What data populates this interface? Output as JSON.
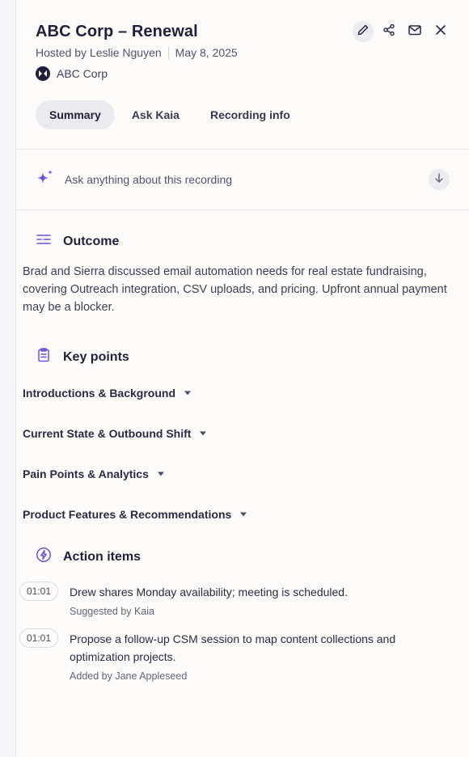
{
  "header": {
    "title": "ABC Corp – Renewal",
    "host": "Hosted by Leslie Nguyen",
    "date": "May 8, 2025",
    "org_name": "ABC Corp"
  },
  "tabs": [
    {
      "label": "Summary",
      "active": true
    },
    {
      "label": "Ask Kaia",
      "active": false
    },
    {
      "label": "Recording info",
      "active": false
    }
  ],
  "ask": {
    "placeholder": "Ask anything about this recording"
  },
  "outcome": {
    "heading": "Outcome",
    "text": "Brad and Sierra discussed email automation needs for real estate fundraising, covering Outreach integration, CSV uploads, and pricing. Upfront annual payment may be a blocker."
  },
  "key_points": {
    "heading": "Key points",
    "items": [
      "Introductions & Background",
      "Current State & Outbound Shift",
      "Pain Points & Analytics",
      "Product Features & Recommendations"
    ]
  },
  "action_items": {
    "heading": "Action items",
    "items": [
      {
        "timestamp": "01:01",
        "text": "Drew shares Monday availability; meeting is scheduled.",
        "attribution": "Suggested by Kaia"
      },
      {
        "timestamp": "01:01",
        "text": "Propose a follow-up CSM session to map content collections and optimization projects.",
        "attribution": "Added by Jane Appleseed"
      }
    ]
  },
  "icons": {
    "edit": "pencil-icon",
    "share": "share-icon",
    "email": "mail-icon",
    "close": "close-icon",
    "sparkle": "sparkle-icon",
    "send": "arrow-down-icon",
    "outcome": "list-lines-icon",
    "key_points": "clipboard-icon",
    "action_items": "lightning-icon"
  },
  "colors": {
    "accent": "#6d4fe0",
    "title": "#221f3d",
    "panel": "#fcfbfa"
  }
}
